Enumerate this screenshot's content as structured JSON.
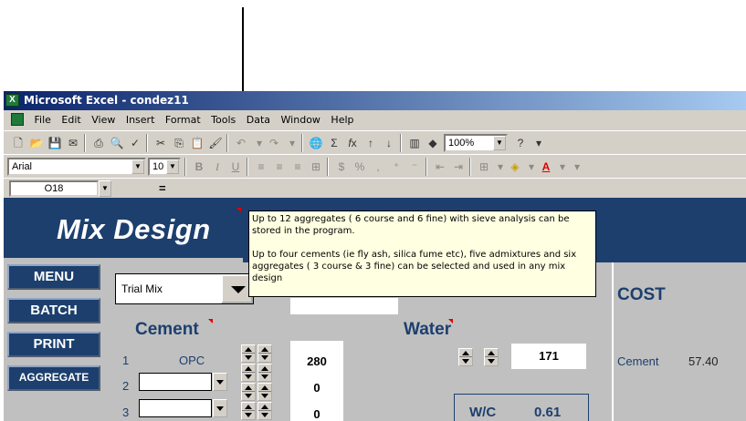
{
  "window": {
    "title": "Microsoft Excel - condez11"
  },
  "menu": [
    "File",
    "Edit",
    "View",
    "Insert",
    "Format",
    "Tools",
    "Data",
    "Window",
    "Help"
  ],
  "toolbar": {
    "zoom": "100%"
  },
  "format_toolbar": {
    "font": "Arial",
    "size": "10",
    "bold": "B",
    "italic": "I",
    "underline": "U",
    "currency": "$",
    "percent": "%",
    "comma": ","
  },
  "formula_bar": {
    "cell_ref": "O18",
    "equals": "="
  },
  "sheet": {
    "title": "Mix Design",
    "nav_buttons": [
      "MENU",
      "BATCH",
      "PRINT",
      "AGGREGATE"
    ],
    "trial_select": "Trial Mix",
    "cement": {
      "heading": "Cement",
      "rows": [
        {
          "num": "1",
          "type": "OPC",
          "value": "280"
        },
        {
          "num": "2",
          "type": "",
          "value": "0"
        },
        {
          "num": "3",
          "type": "",
          "value": "0"
        }
      ]
    },
    "water": {
      "heading": "Water",
      "value": "171"
    },
    "wc": {
      "label": "W/C",
      "value": "0.61"
    },
    "cost": {
      "heading": "COST",
      "label": "Cement",
      "value": "57.40"
    }
  },
  "tooltip": {
    "line1": "Up to 12 aggregates ( 6 course and 6 fine)  with sieve analysis can be stored in the program.",
    "line2": "Up to four cements (ie fly ash, silica fume etc), five admixtures and six aggregates ( 3 course & 3 fine) can be selected and used in any mix design"
  }
}
